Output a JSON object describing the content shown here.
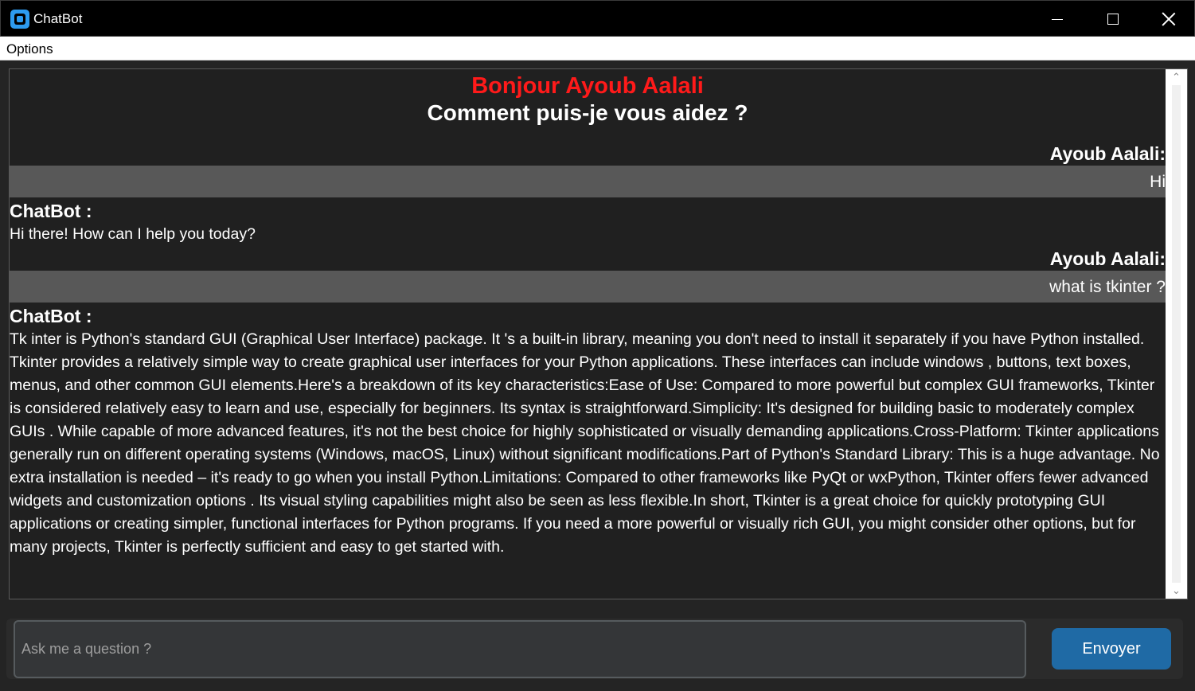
{
  "window": {
    "title": "ChatBot",
    "icon": "chatbot-app-icon"
  },
  "menubar": {
    "items": [
      "Options"
    ]
  },
  "chat": {
    "greeting": "Bonjour Ayoub Aalali",
    "prompt": "Comment puis-je vous aidez ?",
    "messages": [
      {
        "sender": "Ayoub Aalali:",
        "text": "Hi"
      },
      {
        "sender": "ChatBot :",
        "text": "Hi there! How can I help you today?"
      },
      {
        "sender": "Ayoub Aalali:",
        "text": "what is tkinter ?"
      },
      {
        "sender": "ChatBot :",
        "text": "Tk inter is Python's standard GUI (Graphical User Interface) package.  It 's a built-in library, meaning you don't need to install it separately if you have Python installed.  Tkinter provides a relatively simple way to create graphical user interfaces for your Python applications.  These interfaces can include windows , buttons, text boxes, menus, and other common GUI elements.Here's a breakdown of its key characteristics:Ease of Use: Compared to more powerful but complex GUI frameworks, Tkinter is considered relatively easy to learn and use, especially for beginners.  Its syntax is straightforward.Simplicity:  It's designed for building basic to moderately complex GUIs .  While capable of more advanced features, it's not the best choice for highly sophisticated or visually demanding applications.Cross-Platform:  Tkinter applications generally run on different operating systems (Windows, macOS, Linux) without significant modifications.Part of Python's Standard Library: This is a huge advantage.  No extra installation is needed – it's ready to go when you install Python.Limitations:  Compared to other frameworks like PyQt or wxPython, Tkinter offers fewer advanced widgets and customization options .  Its visual styling capabilities might also be seen as less flexible.In short, Tkinter is a great choice for quickly prototyping GUI applications or creating simpler, functional interfaces for Python programs.  If you need a more powerful or visually rich GUI, you might consider other options, but for many projects, Tkinter is perfectly sufficient and easy to get started with."
      }
    ]
  },
  "input": {
    "placeholder": "Ask me a question ?",
    "value": ""
  },
  "send_button": {
    "label": "Envoyer"
  },
  "colors": {
    "greeting": "#ff1a1a",
    "user_bubble": "#585858",
    "chat_bg": "#202020",
    "send_button": "#1f6aa5"
  }
}
